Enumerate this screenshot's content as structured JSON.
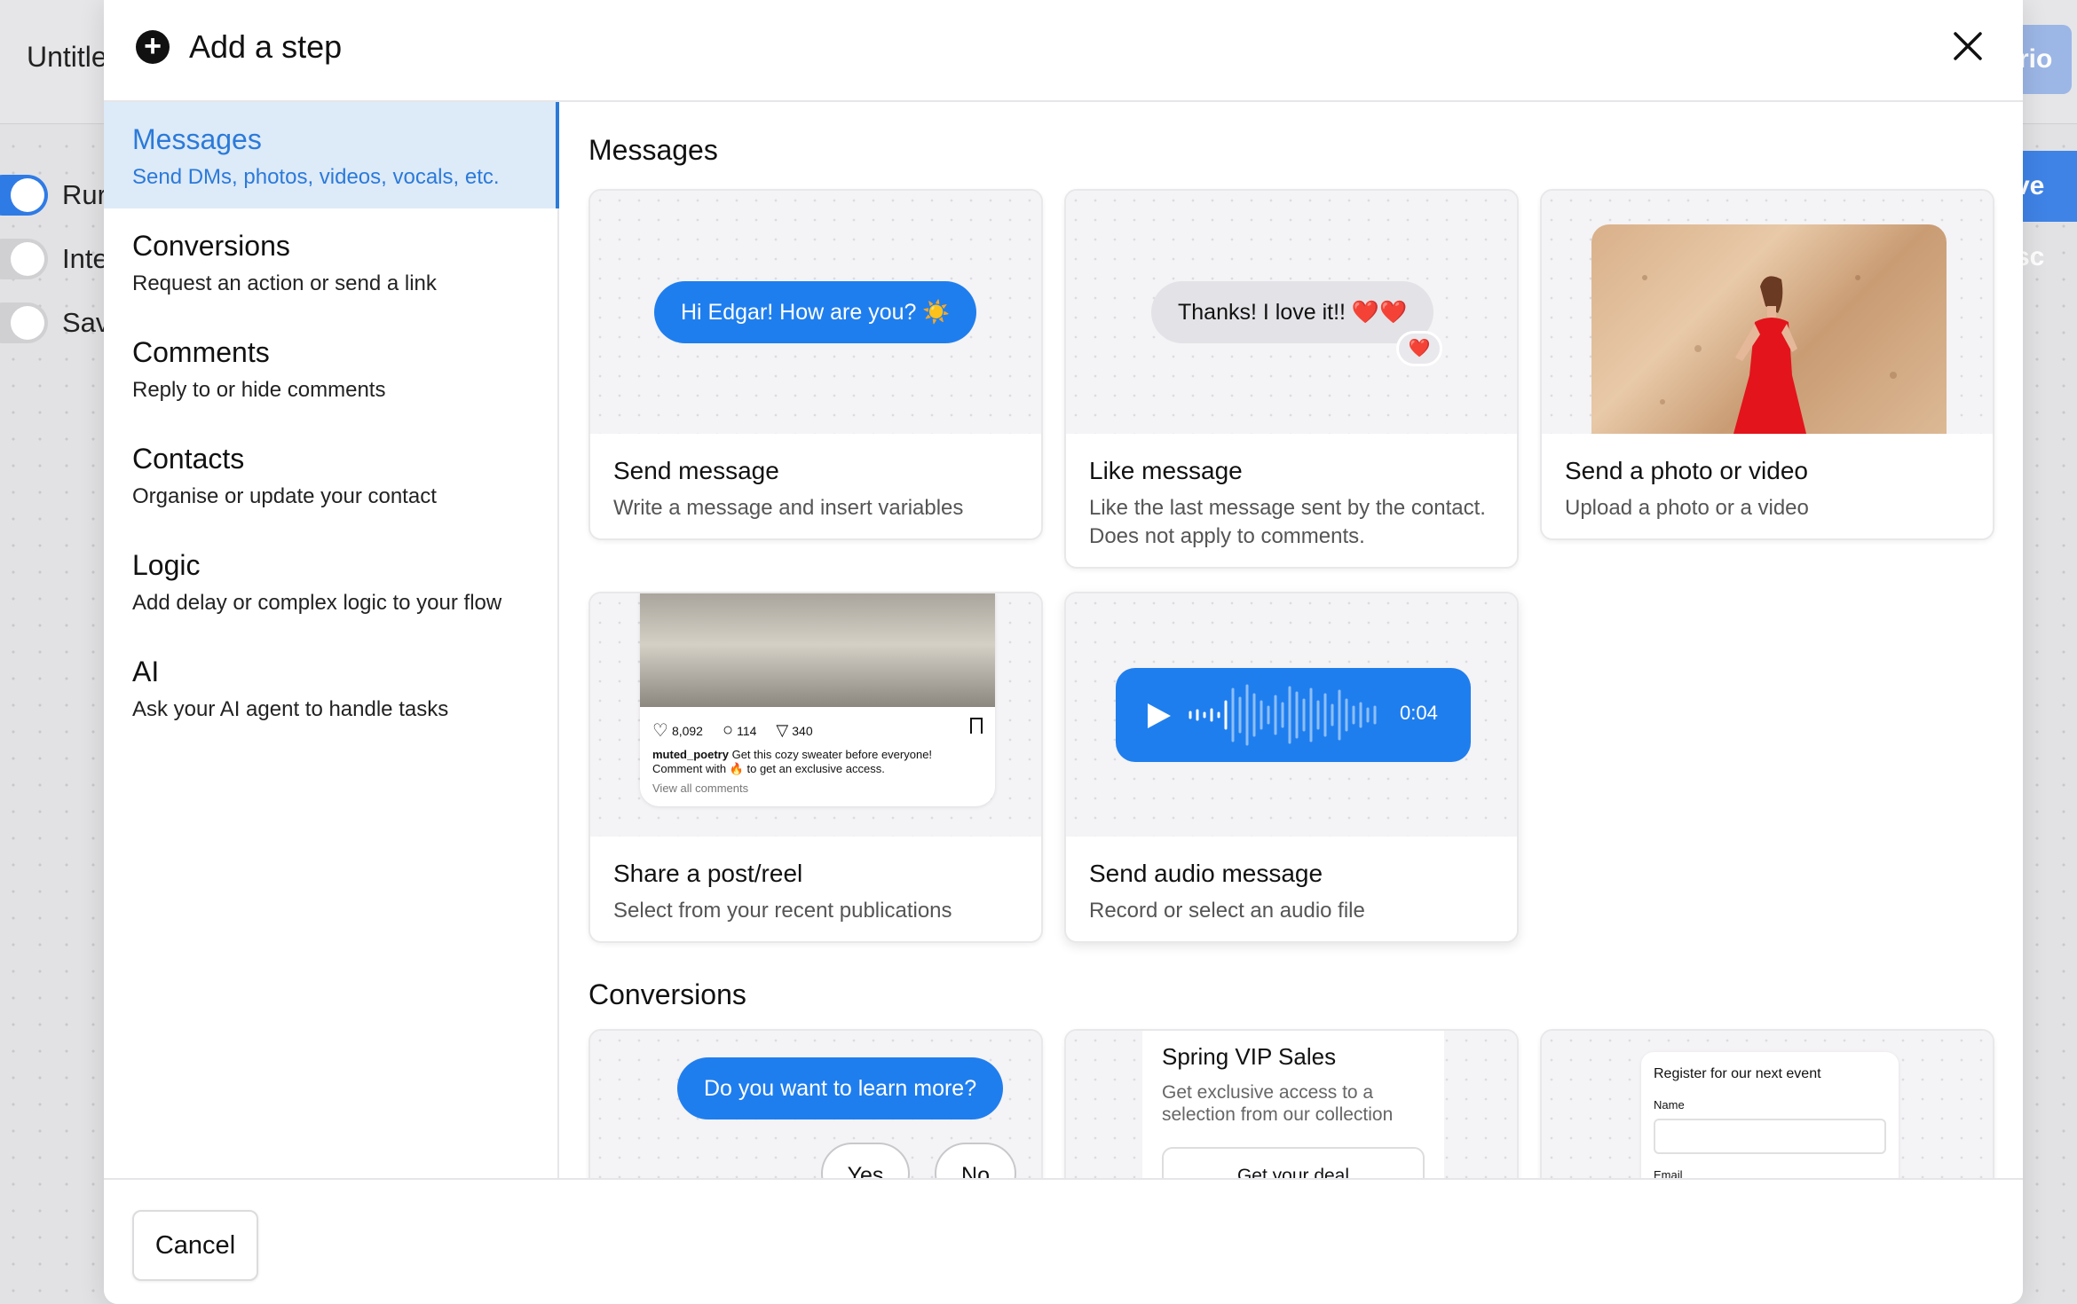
{
  "background": {
    "title": "Untitle",
    "button_top": "rio",
    "button_side": "ve sc",
    "toggles": [
      {
        "label": "Rur",
        "on": true
      },
      {
        "label": "Inte",
        "on": false
      },
      {
        "label": "Sav",
        "on": false
      }
    ]
  },
  "modal": {
    "title": "Add a step",
    "plus_icon": "+",
    "close_icon": "close-icon"
  },
  "sidebar": {
    "items": [
      {
        "title": "Messages",
        "desc": "Send DMs, photos, videos, vocals, etc.",
        "active": true
      },
      {
        "title": "Conversions",
        "desc": "Request an action or send a link"
      },
      {
        "title": "Comments",
        "desc": "Reply to or hide comments"
      },
      {
        "title": "Contacts",
        "desc": "Organise or update your contact"
      },
      {
        "title": "Logic",
        "desc": "Add delay or complex logic to your flow"
      },
      {
        "title": "AI",
        "desc": "Ask your AI agent to handle tasks"
      }
    ]
  },
  "sections": {
    "messages": "Messages",
    "conversions": "Conversions"
  },
  "cards": {
    "send_message": {
      "title": "Send message",
      "desc": "Write a message and insert variables",
      "bubble": "Hi Edgar! How are you? ☀️"
    },
    "like_message": {
      "title": "Like message",
      "desc": "Like the last message sent by the contact. Does not apply to comments.",
      "bubble": "Thanks! I love it!! ❤️❤️",
      "reaction": "❤️"
    },
    "send_photo": {
      "title": "Send a photo or video",
      "desc": "Upload a photo or a video"
    },
    "share_post": {
      "title": "Share a post/reel",
      "desc": "Select from your recent publications",
      "likes": "8,092",
      "comments": "114",
      "shares": "340",
      "username": "muted_poetry",
      "caption": "Get this cozy sweater before everyone!",
      "caption2": "Comment with 🔥 to get an exclusive access.",
      "view_all": "View all comments"
    },
    "send_audio": {
      "title": "Send audio message",
      "desc": "Record or select an audio file",
      "duration": "0:04"
    },
    "conv_question": {
      "bubble": "Do you want to learn more?",
      "yes": "Yes",
      "no": "No"
    },
    "conv_link": {
      "title": "Spring VIP Sales",
      "desc": "Get exclusive access to a selection from our collection",
      "button": "Get your deal"
    },
    "conv_form": {
      "title": "Register for our next event",
      "field1": "Name",
      "field2": "Email"
    }
  },
  "footer": {
    "cancel": "Cancel"
  },
  "colors": {
    "accent": "#1f7eee",
    "active_bg": "#ddeaf8",
    "active_text": "#2b7ad9"
  }
}
